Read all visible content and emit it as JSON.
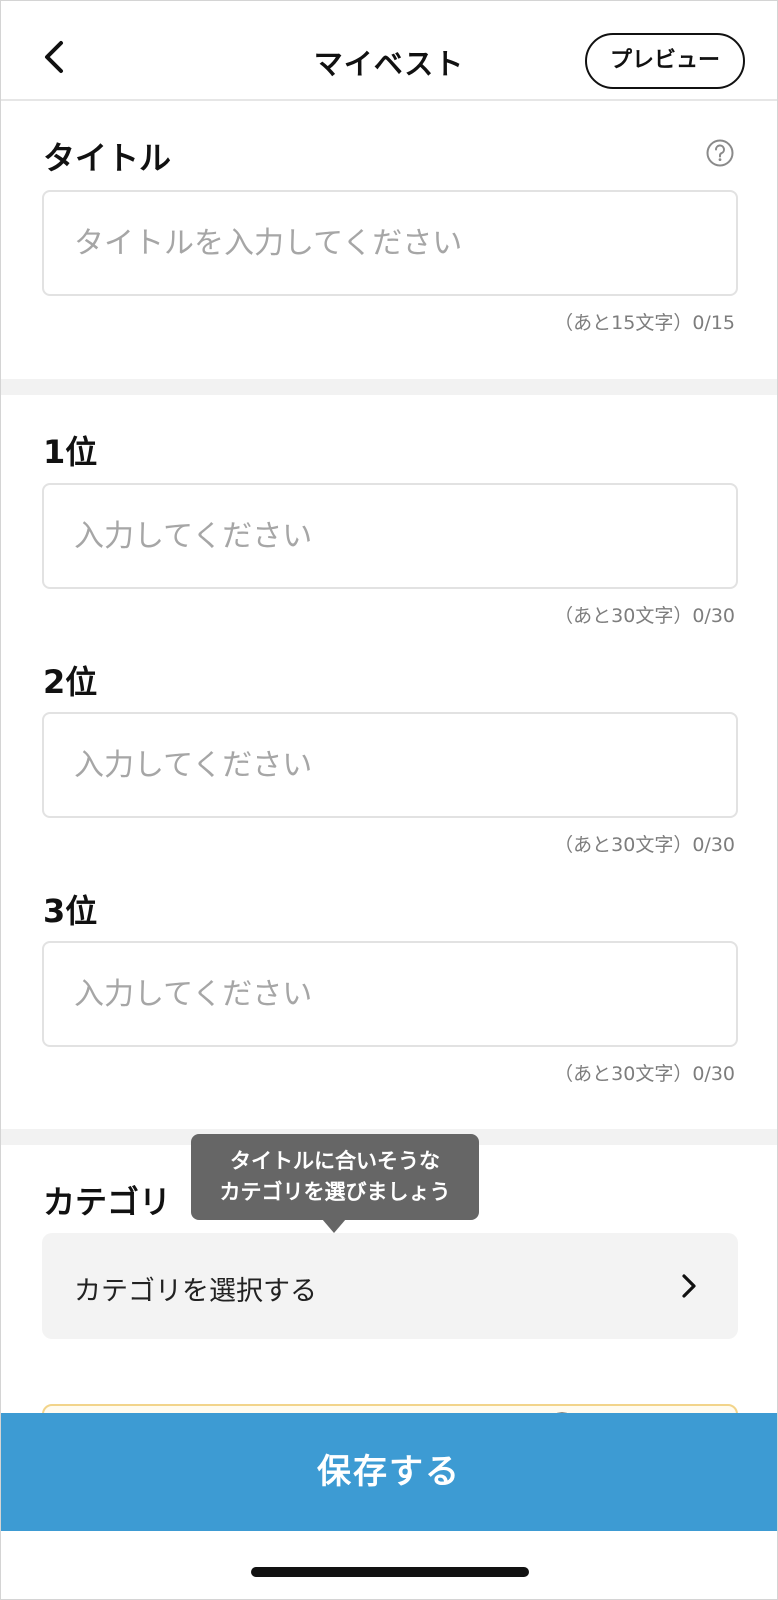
{
  "header": {
    "title": "マイベスト",
    "preview_label": "プレビュー"
  },
  "title_section": {
    "label": "タイトル",
    "placeholder": "タイトルを入力してください",
    "value": "",
    "counter": "（あと15文字）0/15"
  },
  "ranks": [
    {
      "label": "1位",
      "placeholder": "入力してください",
      "value": "",
      "counter": "（あと30文字）0/30"
    },
    {
      "label": "2位",
      "placeholder": "入力してください",
      "value": "",
      "counter": "（あと30文字）0/30"
    },
    {
      "label": "3位",
      "placeholder": "入力してください",
      "value": "",
      "counter": "（あと30文字）0/30"
    }
  ],
  "category": {
    "label": "カテゴリ",
    "tooltip_line1": "タイトルに合いそうな",
    "tooltip_line2": "カテゴリを選びましょう",
    "select_label": "カテゴリを選択する"
  },
  "save_label": "保存する",
  "icons": {
    "back": "chevron-left-icon",
    "help": "question-circle-icon",
    "select": "chevron-right-icon"
  },
  "colors": {
    "accent": "#3d9bd3",
    "tooltip_bg": "#666666",
    "placeholder": "#a6a6a6"
  }
}
